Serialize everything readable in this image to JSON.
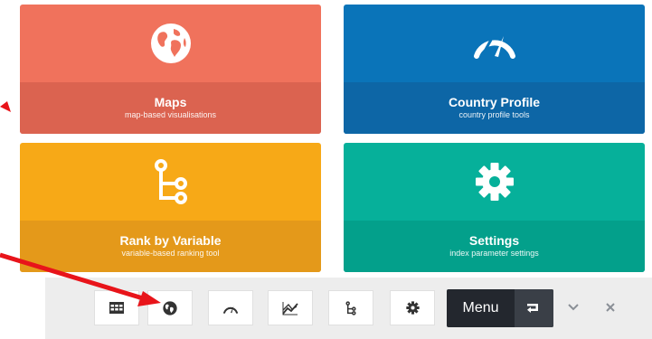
{
  "tiles": {
    "maps": {
      "title": "Maps",
      "subtitle": "map-based visualisations",
      "icon": "globe-icon"
    },
    "country": {
      "title": "Country Profile",
      "subtitle": "country profile tools",
      "icon": "gauge-icon"
    },
    "rank": {
      "title": "Rank by Variable",
      "subtitle": "variable-based ranking tool",
      "icon": "branch-icon"
    },
    "settings": {
      "title": "Settings",
      "subtitle": "index parameter settings",
      "icon": "gear-icon"
    }
  },
  "toolbar": {
    "buttons": [
      "table-icon",
      "globe-icon",
      "gauge-icon",
      "chart-line-icon",
      "branch-icon",
      "gear-icon"
    ],
    "menu_label": "Menu",
    "menu_icon": "exit-icon",
    "collapse_icon": "chevron-down-icon",
    "close_icon": "close-icon"
  },
  "colors": {
    "maps": "#f0725c",
    "country": "#0a74b9",
    "rank": "#f7a917",
    "settings": "#06b09a",
    "arrows": "#e8141a"
  }
}
